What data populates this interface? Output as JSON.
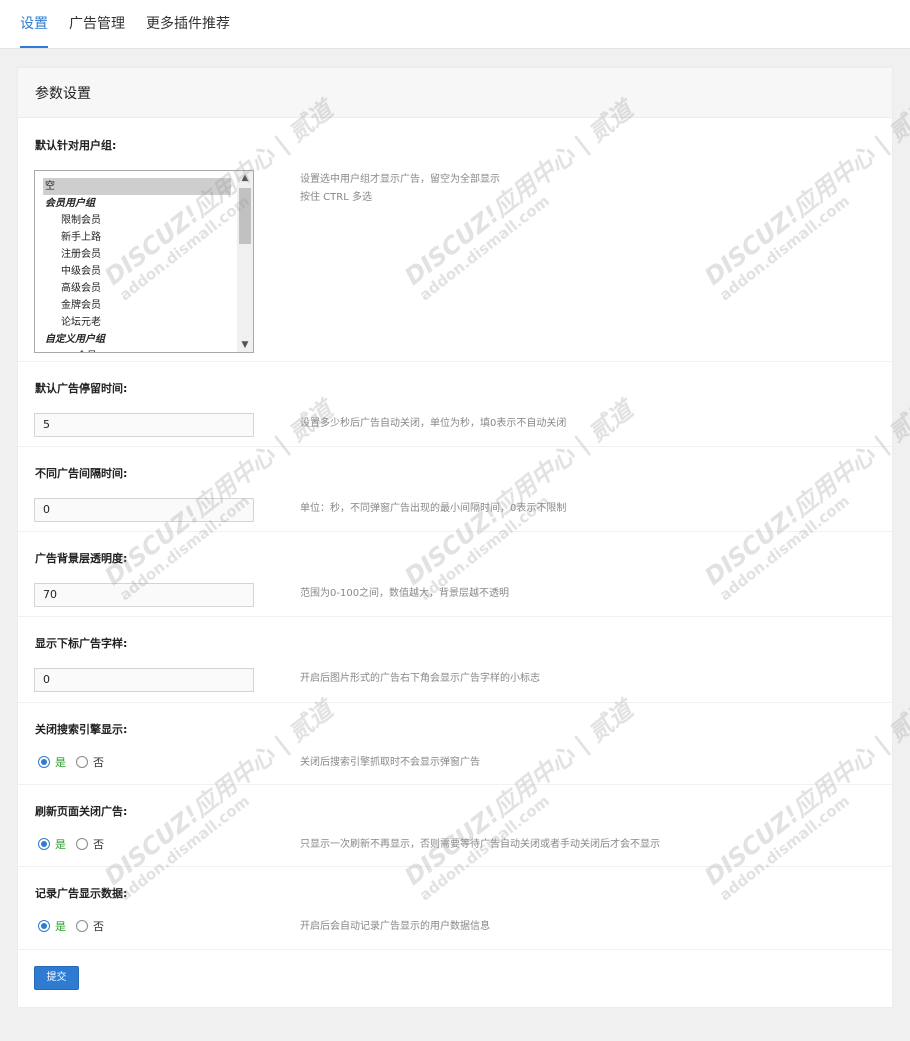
{
  "tabs": [
    {
      "label": "设置",
      "active": true
    },
    {
      "label": "广告管理",
      "active": false
    },
    {
      "label": "更多插件推荐",
      "active": false
    }
  ],
  "panel": {
    "title": "参数设置",
    "submit_label": "提交"
  },
  "fields": {
    "usergroup": {
      "label": "默认针对用户组:",
      "hint": "设置选中用户组才显示广告，留空为全部显示",
      "hint2": "按住 CTRL 多选",
      "options": [
        {
          "text": "空",
          "type": "option",
          "selected": true
        },
        {
          "text": "会员用户组",
          "type": "group"
        },
        {
          "text": "限制会员",
          "type": "child"
        },
        {
          "text": "新手上路",
          "type": "child"
        },
        {
          "text": "注册会员",
          "type": "child"
        },
        {
          "text": "中级会员",
          "type": "child"
        },
        {
          "text": "高级会员",
          "type": "child"
        },
        {
          "text": "金牌会员",
          "type": "child"
        },
        {
          "text": "论坛元老",
          "type": "child"
        },
        {
          "text": "自定义用户组",
          "type": "group"
        },
        {
          "text": "VIP会员",
          "type": "child"
        }
      ]
    },
    "stay_time": {
      "label": "默认广告停留时间:",
      "value": "5",
      "hint": "设置多少秒后广告自动关闭，单位为秒，填0表示不自动关闭"
    },
    "interval": {
      "label": "不同广告间隔时间:",
      "value": "0",
      "hint": "单位：秒，不同弹窗广告出现的最小间隔时间，0表示不限制"
    },
    "opacity": {
      "label": "广告背景层透明度:",
      "value": "70",
      "hint": "范围为0-100之间，数值越大，背景层越不透明"
    },
    "corner_tag": {
      "label": "显示下标广告字样:",
      "value": "0",
      "hint": "开启后图片形式的广告右下角会显示广告字样的小标志"
    },
    "seo_close": {
      "label": "关闭搜索引擎显示:",
      "yes": "是",
      "no": "否",
      "selected": "yes",
      "hint": "关闭后搜索引擎抓取时不会显示弹窗广告"
    },
    "refresh_close": {
      "label": "刷新页面关闭广告:",
      "yes": "是",
      "no": "否",
      "selected": "yes",
      "hint": "只显示一次刷新不再显示，否则需要等待广告自动关闭或者手动关闭后才会不显示"
    },
    "record": {
      "label": "记录广告显示数据:",
      "yes": "是",
      "no": "否",
      "selected": "yes",
      "hint": "开启后会自动记录广告显示的用户数据信息"
    }
  },
  "watermark": {
    "line1": "DISCUZ!应用中心 | 贰道",
    "line2": "addon.dismall.com"
  },
  "colors": {
    "accent": "#2f7bd2",
    "yes_green": "#2a9d2a"
  }
}
